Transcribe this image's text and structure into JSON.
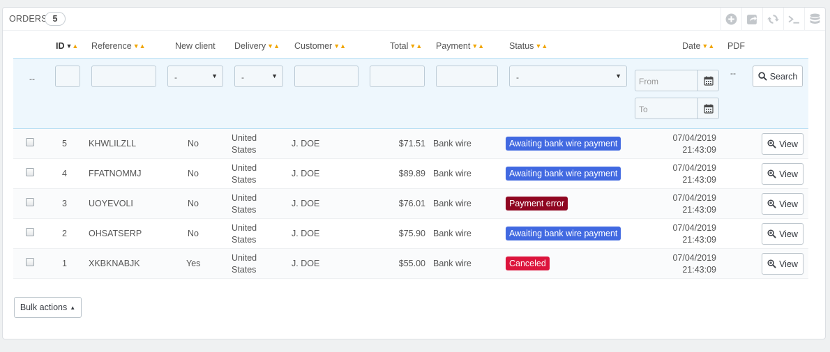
{
  "panel": {
    "title": "ORDERS",
    "count": "5"
  },
  "toolbar": {
    "icons": [
      "add-icon",
      "export-icon",
      "refresh-icon",
      "sql-query-icon",
      "sql-manager-icon"
    ]
  },
  "columns": {
    "id": "ID",
    "reference": "Reference",
    "new_client": "New client",
    "delivery": "Delivery",
    "customer": "Customer",
    "total": "Total",
    "payment": "Payment",
    "status": "Status",
    "date": "Date",
    "pdf": "PDF"
  },
  "filters": {
    "checkbox_dash": "--",
    "new_client_value": "-",
    "delivery_value": "-",
    "status_value": "-",
    "date_from_placeholder": "From",
    "date_to_placeholder": "To",
    "pdf_dash": "--",
    "search_label": "Search"
  },
  "rows": [
    {
      "id": "5",
      "reference": "KHWLILZLL",
      "new_client": "No",
      "delivery_line1": "United",
      "delivery_line2": "States",
      "customer": "J. DOE",
      "total": "$71.51",
      "payment": "Bank wire",
      "status": "Awaiting bank wire payment",
      "status_color": "#4169e1",
      "date": "07/04/2019",
      "time": "21:43:09",
      "view": "View"
    },
    {
      "id": "4",
      "reference": "FFATNOMMJ",
      "new_client": "No",
      "delivery_line1": "United",
      "delivery_line2": "States",
      "customer": "J. DOE",
      "total": "$89.89",
      "payment": "Bank wire",
      "status": "Awaiting bank wire payment",
      "status_color": "#4169e1",
      "date": "07/04/2019",
      "time": "21:43:09",
      "view": "View"
    },
    {
      "id": "3",
      "reference": "UOYEVOLI",
      "new_client": "No",
      "delivery_line1": "United",
      "delivery_line2": "States",
      "customer": "J. DOE",
      "total": "$76.01",
      "payment": "Bank wire",
      "status": "Payment error",
      "status_color": "#8f0621",
      "date": "07/04/2019",
      "time": "21:43:09",
      "view": "View"
    },
    {
      "id": "2",
      "reference": "OHSATSERP",
      "new_client": "No",
      "delivery_line1": "United",
      "delivery_line2": "States",
      "customer": "J. DOE",
      "total": "$75.90",
      "payment": "Bank wire",
      "status": "Awaiting bank wire payment",
      "status_color": "#4169e1",
      "date": "07/04/2019",
      "time": "21:43:09",
      "view": "View"
    },
    {
      "id": "1",
      "reference": "XKBKNABJK",
      "new_client": "Yes",
      "delivery_line1": "United",
      "delivery_line2": "States",
      "customer": "J. DOE",
      "total": "$55.00",
      "payment": "Bank wire",
      "status": "Canceled",
      "status_color": "#dc143c",
      "date": "07/04/2019",
      "time": "21:43:09",
      "view": "View"
    }
  ],
  "bulk_actions": {
    "label": "Bulk actions"
  }
}
